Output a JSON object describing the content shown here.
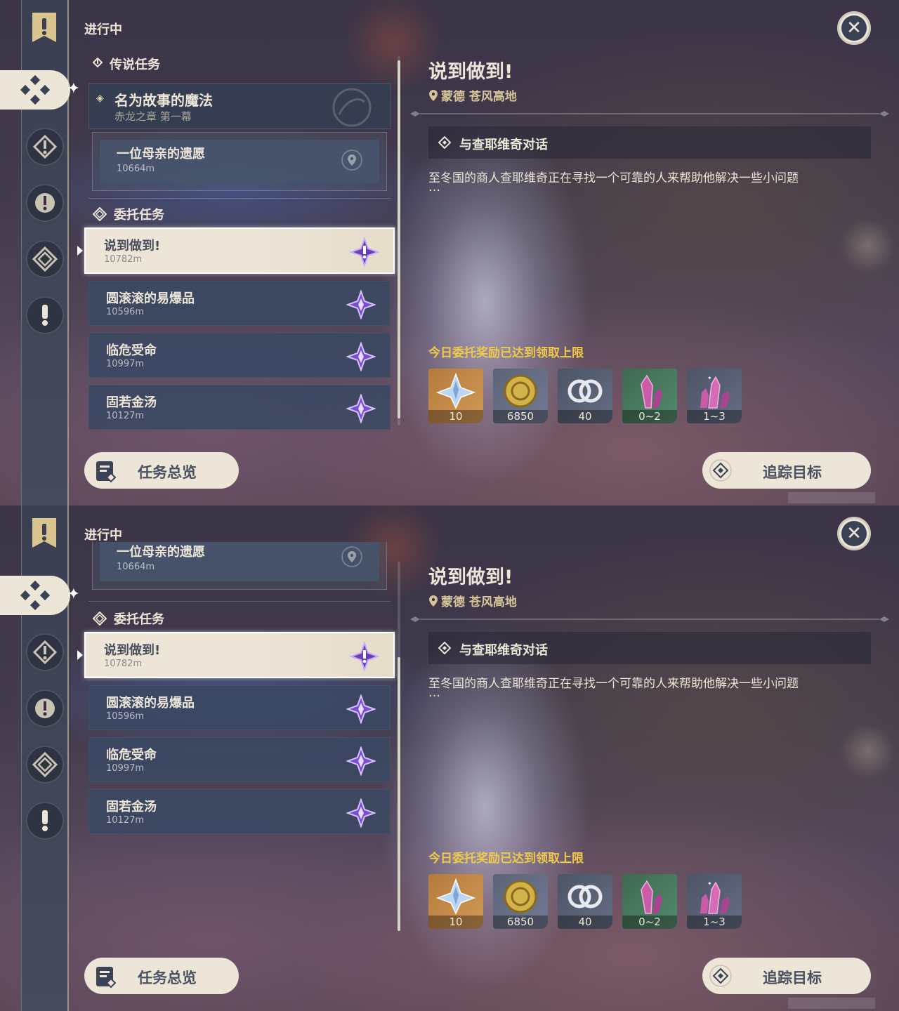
{
  "screens": [
    {
      "header": "进行中",
      "legend_section": {
        "label": "传说任务",
        "quest_title": "名为故事的魔法",
        "quest_sub": "赤龙之章 第一幕",
        "subquest_title": "一位母亲的遗愿",
        "subquest_dist": "10664m"
      },
      "commission_label": "委托任务",
      "quests": [
        {
          "title": "说到做到!",
          "dist": "10782m"
        },
        {
          "title": "圆滚滚的易爆品",
          "dist": "10596m"
        },
        {
          "title": "临危受命",
          "dist": "10997m"
        },
        {
          "title": "固若金汤",
          "dist": "10127m"
        }
      ],
      "detail": {
        "title": "说到做到!",
        "location": "蒙德 苍风高地",
        "objective": "与查耶维奇对话",
        "description": "至冬国的商人查耶维奇正在寻找一个可靠的人来帮助他解决一些小问题",
        "ellipsis": "…",
        "reward_note": "今日委托奖励已达到领取上限",
        "rewards": [
          {
            "name": "primogem-icon",
            "qty": "10"
          },
          {
            "name": "mora-icon",
            "qty": "6850"
          },
          {
            "name": "friendship-exp-icon",
            "qty": "40"
          },
          {
            "name": "crystal-chunk-icon",
            "qty": "0~2"
          },
          {
            "name": "crystal-cluster-icon",
            "qty": "1~3"
          }
        ]
      },
      "buttons": {
        "overview": "任务总览",
        "track": "追踪目标"
      }
    },
    {
      "header": "进行中",
      "subquest": {
        "title": "一位母亲的遗愿",
        "dist": "10664m"
      },
      "commission_label": "委托任务",
      "quests": [
        {
          "title": "说到做到!",
          "dist": "10782m"
        },
        {
          "title": "圆滚滚的易爆品",
          "dist": "10596m"
        },
        {
          "title": "临危受命",
          "dist": "10997m"
        },
        {
          "title": "固若金汤",
          "dist": "10127m"
        }
      ],
      "detail": {
        "title": "说到做到!",
        "location": "蒙德 苍风高地",
        "objective": "与查耶维奇对话",
        "description": "至冬国的商人查耶维奇正在寻找一个可靠的人来帮助他解决一些小问题",
        "ellipsis": "…",
        "reward_note": "今日委托奖励已达到领取上限",
        "rewards": [
          {
            "name": "primogem-icon",
            "qty": "10"
          },
          {
            "name": "mora-icon",
            "qty": "6850"
          },
          {
            "name": "friendship-exp-icon",
            "qty": "40"
          },
          {
            "name": "crystal-chunk-icon",
            "qty": "0~2"
          },
          {
            "name": "crystal-cluster-icon",
            "qty": "1~3"
          }
        ]
      },
      "buttons": {
        "overview": "任务总览",
        "track": "追踪目标"
      }
    }
  ],
  "colors": {
    "accent_cream": "#ece5d8",
    "reward_note": "#f0c84a",
    "commission_purple": "#8a5cd0",
    "panel_blue": "#3a4862"
  }
}
